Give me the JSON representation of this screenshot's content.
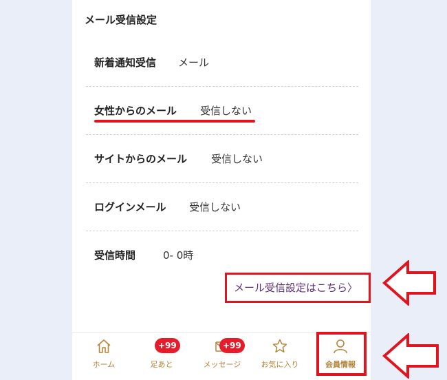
{
  "section": {
    "title": "メール受信設定"
  },
  "settings": [
    {
      "label": "新着通知受信",
      "value": "メール"
    },
    {
      "label": "女性からのメール",
      "value": "受信しない"
    },
    {
      "label": "サイトからのメール",
      "value": "受信しない"
    },
    {
      "label": "ログインメール",
      "value": "受信しない"
    },
    {
      "label": "受信時間",
      "value": "0- 0時"
    }
  ],
  "link": {
    "text": "メール受信設定はこちら",
    "chevron": "〉"
  },
  "nav": [
    {
      "label": "ホーム",
      "icon": "home-icon"
    },
    {
      "label": "足あと",
      "icon": "footprint-icon",
      "badge": "+99"
    },
    {
      "label": "メッセージ",
      "icon": "mail-icon",
      "badge": "+99"
    },
    {
      "label": "お気に入り",
      "icon": "star-icon"
    },
    {
      "label": "会員情報",
      "icon": "person-icon"
    }
  ],
  "colors": {
    "accent": "#b5853a",
    "highlight": "#e0141e",
    "link": "#5b2e7a",
    "badge": "#e51d2a"
  }
}
